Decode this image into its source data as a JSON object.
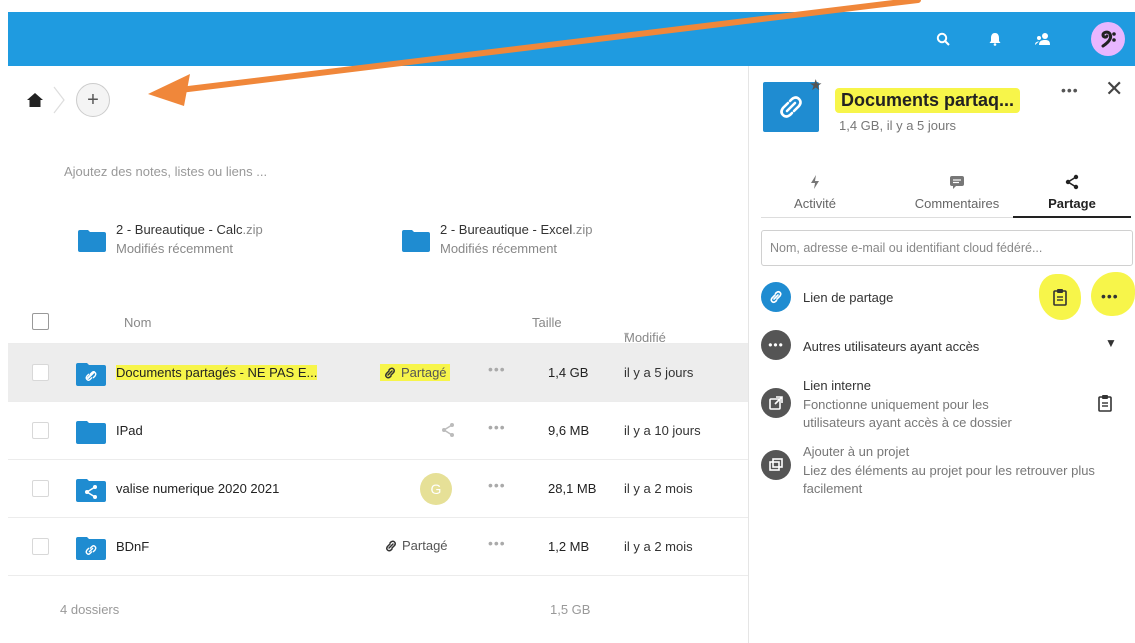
{
  "files": {
    "notes_placeholder": "Ajoutez des notes, listes ou liens ...",
    "recent": [
      {
        "name": "2 - Bureautique - Calc",
        "ext": ".zip",
        "sub": "Modifiés récemment"
      },
      {
        "name": "2 - Bureautique - Excel",
        "ext": ".zip",
        "sub": "Modifiés récemment"
      }
    ],
    "columns": {
      "name": "Nom",
      "size": "Taille",
      "modified": "Modifié"
    },
    "rows": [
      {
        "name": "Documents partagés - NE PAS E...",
        "share": "Partagé",
        "size": "1,4 GB",
        "modified": "il y a 5 jours"
      },
      {
        "name": "IPad",
        "share": "",
        "size": "9,6 MB",
        "modified": "il y a 10 jours"
      },
      {
        "name": "valise numerique 2020 2021",
        "share": "G",
        "size": "28,1 MB",
        "modified": "il y a 2 mois"
      },
      {
        "name": "BDnF",
        "share": "Partagé",
        "size": "1,2 MB",
        "modified": "il y a 2 mois"
      }
    ],
    "footer": {
      "count": "4 dossiers",
      "total": "1,5 GB"
    }
  },
  "sidebar": {
    "title": "Documents partaq...",
    "subtitle": "1,4 GB, il y a 5 jours",
    "tabs": {
      "activity": "Activité",
      "comments": "Commentaires",
      "sharing": "Partage"
    },
    "share_input_placeholder": "Nom, adresse e-mail ou identifiant cloud fédéré...",
    "link": {
      "label": "Lien de partage"
    },
    "others": {
      "label": "Autres utilisateurs ayant accès"
    },
    "internal": {
      "label": "Lien interne",
      "sub": "Fonctionne uniquement pour les utilisateurs ayant accès à ce dossier"
    },
    "project": {
      "label": "Ajouter à un projet",
      "sub": "Liez des éléments au projet pour les retrouver plus facilement"
    }
  },
  "colors": {
    "header": "#1f9be0",
    "folder": "#1f8cd1",
    "highlight": "#f7f54a",
    "arrow": "#f0873a"
  }
}
